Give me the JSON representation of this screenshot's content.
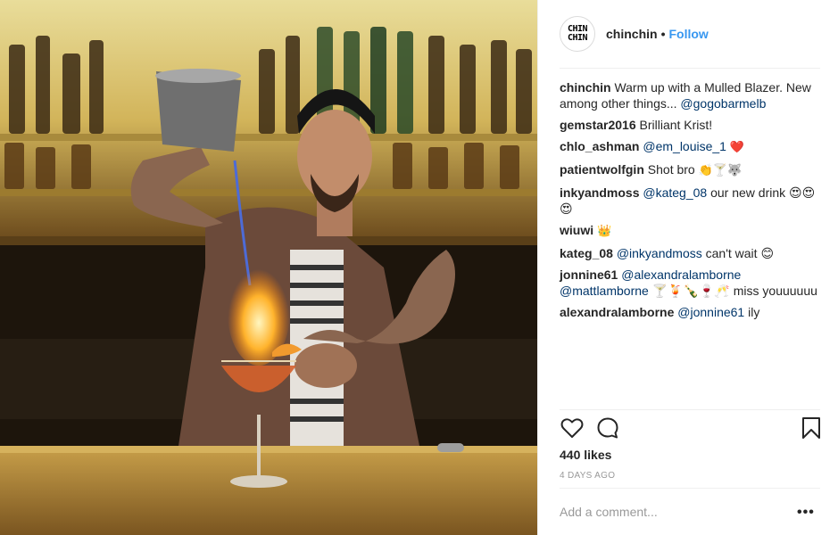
{
  "post": {
    "author": "chinchin",
    "avatar_text_line1": "CHIN",
    "avatar_text_line2": "CHIN",
    "separator": "•",
    "follow_label": "Follow",
    "likes": "440 likes",
    "timestamp": "4 DAYS AGO",
    "add_comment_placeholder": "Add a comment...",
    "more_label": "•••"
  },
  "comments": [
    {
      "user": "chinchin",
      "text": "Warm up with a Mulled Blazer. New among other things...",
      "mention": "@gogobarmelb",
      "tail": ""
    },
    {
      "user": "gemstar2016",
      "text": "Brilliant Krist!",
      "mention": "",
      "tail": ""
    },
    {
      "user": "chlo_ashman",
      "text": "",
      "mention": "@em_louise_1",
      "tail": "❤️"
    },
    {
      "user": "patientwolfgin",
      "text": "Shot bro",
      "mention": "",
      "tail": "👏🍸🐺"
    },
    {
      "user": "inkyandmoss",
      "text": "",
      "mention": "@kateg_08",
      "tail": "our new drink 😍😍😍"
    },
    {
      "user": "wiuwi",
      "text": "👑",
      "mention": "",
      "tail": ""
    },
    {
      "user": "kateg_08",
      "text": "",
      "mention": "@inkyandmoss",
      "tail": "can't wait 😊"
    },
    {
      "user": "jonnine61",
      "text": "",
      "mention": "@alexandralamborne @mattlamborne",
      "tail": "🍸🍹🍾🍷🥂 miss youuuuuu"
    },
    {
      "user": "alexandralamborne",
      "text": "",
      "mention": "@jonnine61",
      "tail": "ily"
    }
  ],
  "icons": {
    "like": "heart-icon",
    "comment": "comment-bubble-icon",
    "save": "bookmark-icon"
  },
  "colors": {
    "link": "#3897f0",
    "mention": "#003569",
    "meta": "#999999"
  }
}
